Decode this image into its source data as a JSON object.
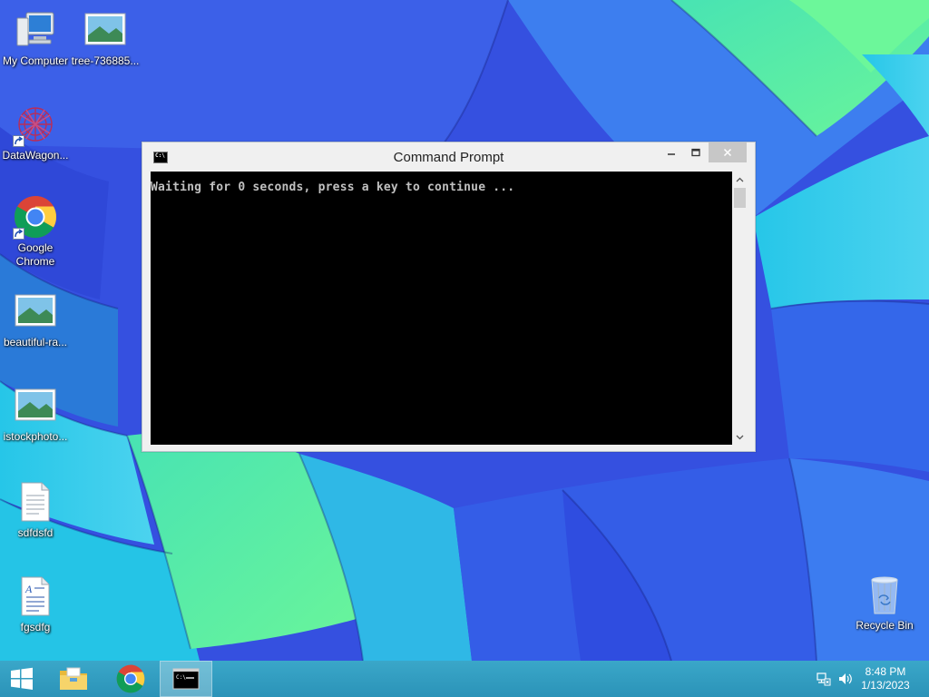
{
  "desktop": {
    "icons": [
      {
        "label": "My Computer",
        "icon": "computer-icon"
      },
      {
        "label": "tree-736885...",
        "icon": "image-file-icon"
      },
      {
        "label": "DataWagon...",
        "icon": "datawagon-shortcut-icon"
      },
      {
        "label": "Google Chrome",
        "icon": "chrome-icon"
      },
      {
        "label": "beautiful-ra...",
        "icon": "image-file-icon"
      },
      {
        "label": "istockphoto...",
        "icon": "image-file-icon"
      },
      {
        "label": "sdfdsfd",
        "icon": "text-file-icon"
      },
      {
        "label": "fgsdfg",
        "icon": "wordpad-file-icon"
      },
      {
        "label": "Recycle Bin",
        "icon": "recycle-bin-icon"
      }
    ]
  },
  "window": {
    "title": "Command Prompt",
    "console_line": "Waiting for 0 seconds, press a key to continue ..."
  },
  "taskbar": {
    "items": [
      "start-icon",
      "file-explorer-icon",
      "chrome-icon",
      "command-prompt-icon"
    ],
    "clock": {
      "time": "8:48 PM",
      "date": "1/13/2023"
    }
  },
  "colors": {
    "taskbar": "#2b93b8",
    "console_bg": "#000000",
    "console_text": "#c0c0c0"
  }
}
